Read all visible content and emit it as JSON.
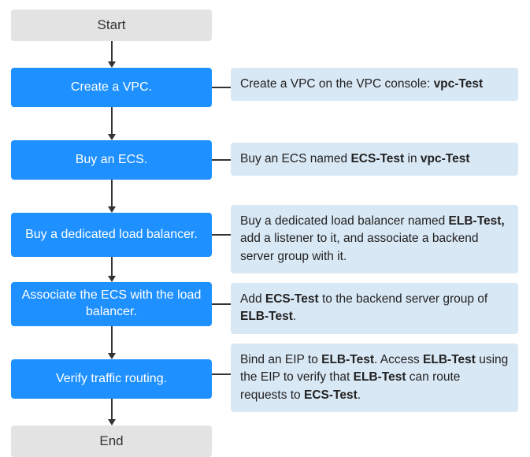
{
  "flow": {
    "start": "Start",
    "end": "End",
    "steps": [
      {
        "label": "Create a VPC."
      },
      {
        "label": "Buy an ECS."
      },
      {
        "label": "Buy a dedicated load balancer."
      },
      {
        "label": "Associate the ECS with the load balancer."
      },
      {
        "label": "Verify traffic routing."
      }
    ]
  },
  "descriptions": [
    {
      "html": "Create a VPC on the VPC console: <b>vpc-Test</b>"
    },
    {
      "html": "Buy an ECS named <b>ECS-Test</b> in <b>vpc-Test</b>"
    },
    {
      "html": "Buy a dedicated load balancer named <b>ELB-Test,</b> add a listener to it, and associate a backend server group with it."
    },
    {
      "html": "Add <b>ECS-Test</b> to the backend server group of <b>ELB-Test</b>."
    },
    {
      "html": "Bind an EIP to <b>ELB-Test</b>. Access <b>ELB-Test</b> using the EIP to verify that <b>ELB-Test</b> can route requests to <b>ECS-Test</b>."
    }
  ]
}
